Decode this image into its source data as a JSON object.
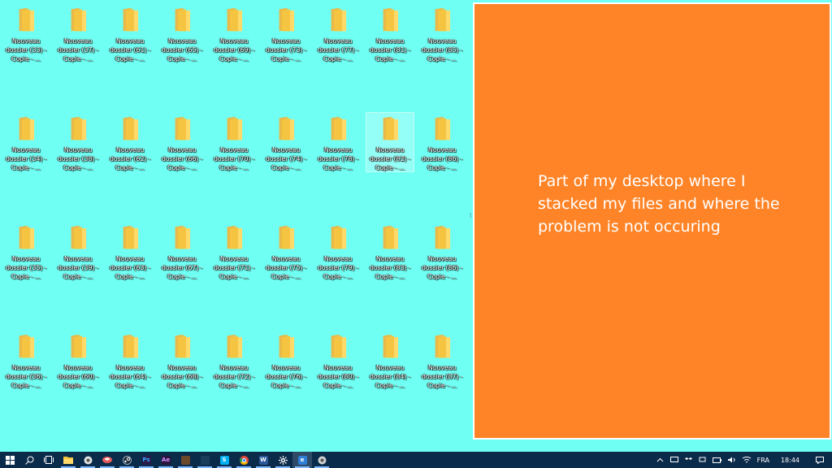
{
  "desktop": {
    "columns": [
      [
        "Nouveau dossier (33) - Copie - ...",
        "Nouveau dossier (34) - Copie - ...",
        "Nouveau dossier (35) - Copie - ...",
        "Nouveau dossier (36) - Copie - ..."
      ],
      [
        "Nouveau dossier (37) - Copie - ...",
        "Nouveau dossier (38) - Copie - ...",
        "Nouveau dossier (39) - Copie - ...",
        "Nouveau dossier (60) - Copie - ..."
      ],
      [
        "Nouveau dossier (61) - Copie - ...",
        "Nouveau dossier (62) - Copie - ...",
        "Nouveau dossier (63) - Copie - ...",
        "Nouveau dossier (64) - Copie - ..."
      ],
      [
        "Nouveau dossier (65) - Copie - ...",
        "Nouveau dossier (66) - Copie - ...",
        "Nouveau dossier (67) - Copie - ...",
        "Nouveau dossier (68) - Copie - ..."
      ],
      [
        "Nouveau dossier (69) - Copie - ...",
        "Nouveau dossier (70) - Copie - ...",
        "Nouveau dossier (71) - Copie - ...",
        "Nouveau dossier (72) - Copie - ..."
      ],
      [
        "Nouveau dossier (73) - Copie - ...",
        "Nouveau dossier (74) - Copie - ...",
        "Nouveau dossier (75) - Copie - ...",
        "Nouveau dossier (76) - Copie - ..."
      ],
      [
        "Nouveau dossier (77) - Copie - ...",
        "Nouveau dossier (78) - Copie - ...",
        "Nouveau dossier (79) - Copie - ...",
        "Nouveau dossier (80) - Copie - ..."
      ],
      [
        "Nouveau dossier (81) - Copie - ...",
        "Nouveau dossier (82) - Copie - ...",
        "Nouveau dossier (83) - Copie - ...",
        "Nouveau dossier (84) - Copie - ..."
      ],
      [
        "Nouveau dossier (85) - Copie - ...",
        "Nouveau dossier (86) - Copie - ...",
        "Nouveau dossier (86) - Copie - ...",
        "Nouveau dossier (87) - Copie - ..."
      ]
    ],
    "selected_icon": "Nouveau dossier (82) - Copie - ..."
  },
  "note": {
    "text": "Part of my desktop where I stacked my files and where the problem is not occuring"
  },
  "taskbar": {
    "apps": [
      {
        "icon": "windows-start-icon",
        "color": "#ffffff",
        "glyph": ""
      },
      {
        "icon": "search-icon",
        "color": "#ffffff",
        "glyph": ""
      },
      {
        "icon": "task-view-icon",
        "color": "#ffffff",
        "glyph": ""
      },
      {
        "icon": "file-explorer-icon",
        "color": "#f5c542",
        "glyph": ""
      },
      {
        "icon": "chrome-canary-icon",
        "color": "#e0e0e0",
        "glyph": ""
      },
      {
        "icon": "media-app-icon",
        "color": "#e85b5b",
        "glyph": ""
      },
      {
        "icon": "steam-icon",
        "color": "#9ab",
        "glyph": ""
      },
      {
        "icon": "photoshop-icon",
        "color": "#2b1b4a",
        "glyph": "Ps"
      },
      {
        "icon": "after-effects-icon",
        "color": "#2a1540",
        "glyph": "Ae"
      },
      {
        "icon": "coffee-app-icon",
        "color": "#6b4a2b",
        "glyph": ""
      },
      {
        "icon": "dark-app-icon",
        "color": "#1b3d5c",
        "glyph": ""
      },
      {
        "icon": "skype-icon",
        "color": "#00aff0",
        "glyph": "S"
      },
      {
        "icon": "chrome-icon",
        "color": "#e8b400",
        "glyph": ""
      },
      {
        "icon": "word-icon",
        "color": "#2b579a",
        "glyph": "W"
      },
      {
        "icon": "settings-icon",
        "color": "#ffffff",
        "glyph": ""
      },
      {
        "icon": "edge-icon",
        "color": "#2f7fd6",
        "glyph": "e"
      },
      {
        "icon": "app-icon",
        "color": "#cfcfcf",
        "glyph": ""
      }
    ],
    "active_index": 15,
    "tray": {
      "language": "FRA",
      "time": "18:44"
    }
  }
}
